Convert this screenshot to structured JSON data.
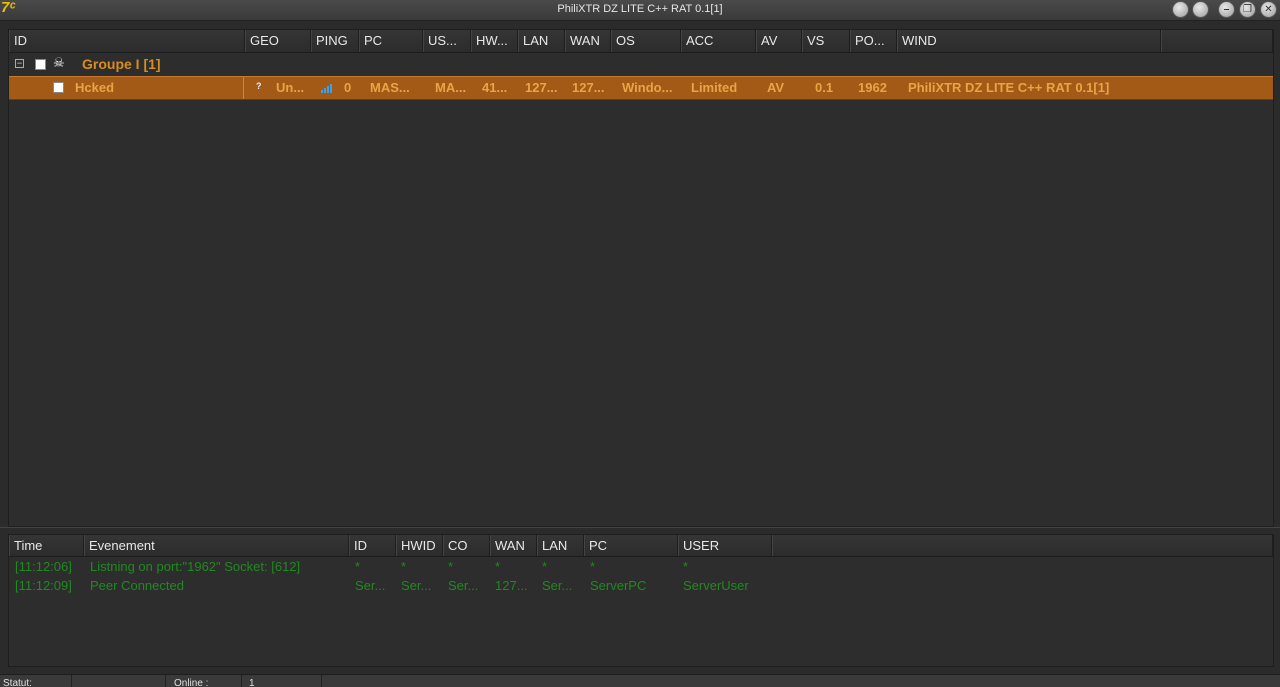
{
  "window": {
    "title": "PhiliXTR DZ LITE C++ RAT 0.1[1]",
    "icon_text": "7ᶜ"
  },
  "clients": {
    "columns": [
      "ID",
      "GEO",
      "PING",
      "PC",
      "US...",
      "HW...",
      "LAN",
      "WAN",
      "OS",
      "ACC",
      "AV",
      "VS",
      "PO...",
      "WIND"
    ],
    "group": {
      "expand_glyph": "⊟",
      "skull_glyph": "☠",
      "label": "Groupe I [1]"
    },
    "row": {
      "id": "Hcked",
      "geo": "?",
      "geo_name": "Un...",
      "ping": "0",
      "pc": "MAS...",
      "user": "MA...",
      "hwid": "41...",
      "lan": "127...",
      "wan": "127...",
      "os": "Windo...",
      "acc": "Limited",
      "av": "AV",
      "vs": "0.1",
      "port": "1962",
      "wind": "PhiliXTR DZ LITE C++ RAT 0.1[1]"
    }
  },
  "log": {
    "columns": [
      "Time",
      "Evenement",
      "ID",
      "HWID",
      "CO",
      "WAN",
      "LAN",
      "PC",
      "USER"
    ],
    "rows": [
      [
        "[11:12:06]",
        "Listning on port:\"1962\" Socket: [612]",
        "*",
        "*",
        "*",
        "*",
        "*",
        "*",
        "*"
      ],
      [
        "[11:12:09]",
        "Peer Connected",
        "Ser...",
        "Ser...",
        "Ser...",
        "127...",
        "Ser...",
        "ServerPC",
        "ServerUser"
      ]
    ]
  },
  "statusbar": {
    "statut_label": "Statut:",
    "statut_value": "",
    "online_label": "Online :",
    "online_value": "1"
  },
  "colors": {
    "accent": "#d98c1e",
    "selected_row": "#a35a17",
    "log_text": "#1f8a1f",
    "background": "#2b2b2b"
  }
}
